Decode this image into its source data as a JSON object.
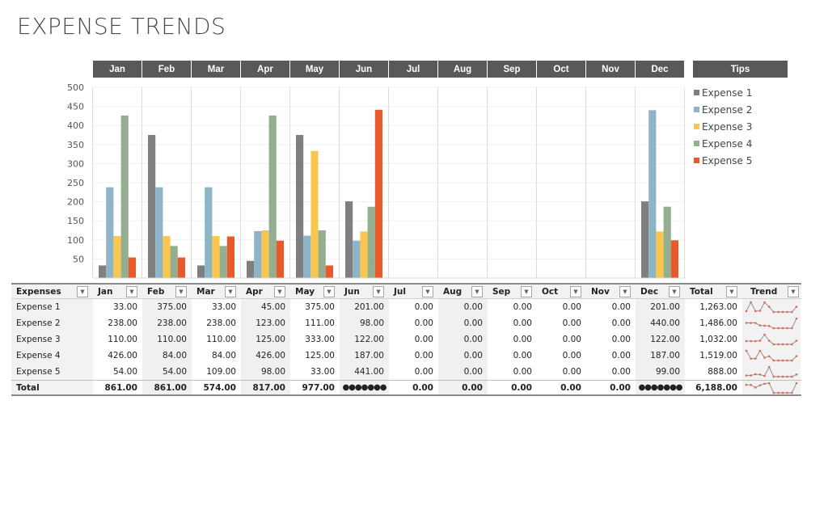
{
  "title": "EXPENSE TRENDS",
  "months": [
    "Jan",
    "Feb",
    "Mar",
    "Apr",
    "May",
    "Jun",
    "Jul",
    "Aug",
    "Sep",
    "Oct",
    "Nov",
    "Dec"
  ],
  "tips_label": "Tips",
  "colors": {
    "header_bg": "#595959",
    "expense1": "#7f7f7f",
    "expense2": "#8eb4c8",
    "expense3": "#f9c74f",
    "expense4": "#94ae90",
    "expense5": "#e85a2c",
    "sparkline": "#e0674a"
  },
  "chart_data": {
    "type": "bar",
    "categories": [
      "Jan",
      "Feb",
      "Mar",
      "Apr",
      "May",
      "Jun",
      "Jul",
      "Aug",
      "Sep",
      "Oct",
      "Nov",
      "Dec"
    ],
    "series": [
      {
        "name": "Expense 1",
        "values": [
          33,
          375,
          33,
          45,
          375,
          201,
          0,
          0,
          0,
          0,
          0,
          201
        ]
      },
      {
        "name": "Expense 2",
        "values": [
          238,
          238,
          238,
          123,
          111,
          98,
          0,
          0,
          0,
          0,
          0,
          440
        ]
      },
      {
        "name": "Expense 3",
        "values": [
          110,
          110,
          110,
          125,
          333,
          122,
          0,
          0,
          0,
          0,
          0,
          122
        ]
      },
      {
        "name": "Expense 4",
        "values": [
          426,
          84,
          84,
          426,
          125,
          187,
          0,
          0,
          0,
          0,
          0,
          187
        ]
      },
      {
        "name": "Expense 5",
        "values": [
          54,
          54,
          109,
          98,
          33,
          441,
          0,
          0,
          0,
          0,
          0,
          99
        ]
      }
    ],
    "yticks": [
      50,
      100,
      150,
      200,
      250,
      300,
      350,
      400,
      450,
      500
    ],
    "ylim": [
      0,
      500
    ],
    "grid": true,
    "legend": "right",
    "title": "",
    "xlabel": "",
    "ylabel": ""
  },
  "table": {
    "headers": {
      "name": "Expenses",
      "months": [
        "Jan",
        "Feb",
        "Mar",
        "Apr",
        "May",
        "Jun",
        "Jul",
        "Aug",
        "Sep",
        "Oct",
        "Nov",
        "Dec"
      ],
      "total": "Total",
      "trend": "Trend"
    },
    "dropdown_icon": "▼",
    "rows": [
      {
        "name": "Expense 1",
        "values": [
          "33.00",
          "375.00",
          "33.00",
          "45.00",
          "375.00",
          "201.00",
          "0.00",
          "0.00",
          "0.00",
          "0.00",
          "0.00",
          "201.00"
        ],
        "total": "1,263.00"
      },
      {
        "name": "Expense 2",
        "values": [
          "238.00",
          "238.00",
          "238.00",
          "123.00",
          "111.00",
          "98.00",
          "0.00",
          "0.00",
          "0.00",
          "0.00",
          "0.00",
          "440.00"
        ],
        "total": "1,486.00"
      },
      {
        "name": "Expense 3",
        "values": [
          "110.00",
          "110.00",
          "110.00",
          "125.00",
          "333.00",
          "122.00",
          "0.00",
          "0.00",
          "0.00",
          "0.00",
          "0.00",
          "122.00"
        ],
        "total": "1,032.00"
      },
      {
        "name": "Expense 4",
        "values": [
          "426.00",
          "84.00",
          "84.00",
          "426.00",
          "125.00",
          "187.00",
          "0.00",
          "0.00",
          "0.00",
          "0.00",
          "0.00",
          "187.00"
        ],
        "total": "1,519.00"
      },
      {
        "name": "Expense 5",
        "values": [
          "54.00",
          "54.00",
          "109.00",
          "98.00",
          "33.00",
          "441.00",
          "0.00",
          "0.00",
          "0.00",
          "0.00",
          "0.00",
          "99.00"
        ],
        "total": "888.00"
      }
    ],
    "total_row": {
      "name": "Total",
      "values": [
        "861.00",
        "861.00",
        "574.00",
        "817.00",
        "977.00",
        "#######",
        "0.00",
        "0.00",
        "0.00",
        "0.00",
        "0.00",
        "#######"
      ],
      "total": "6,188.00"
    },
    "overflow_display": "●●●●●●●",
    "trend_series": [
      [
        33,
        375,
        33,
        45,
        375,
        201,
        0,
        0,
        0,
        0,
        0,
        201
      ],
      [
        238,
        238,
        238,
        123,
        111,
        98,
        0,
        0,
        0,
        0,
        0,
        440
      ],
      [
        110,
        110,
        110,
        125,
        333,
        122,
        0,
        0,
        0,
        0,
        0,
        122
      ],
      [
        426,
        84,
        84,
        426,
        125,
        187,
        0,
        0,
        0,
        0,
        0,
        187
      ],
      [
        54,
        54,
        109,
        98,
        33,
        441,
        0,
        0,
        0,
        0,
        0,
        99
      ],
      [
        861,
        861,
        574,
        817,
        977,
        1049,
        0,
        0,
        0,
        0,
        0,
        1049
      ]
    ]
  }
}
